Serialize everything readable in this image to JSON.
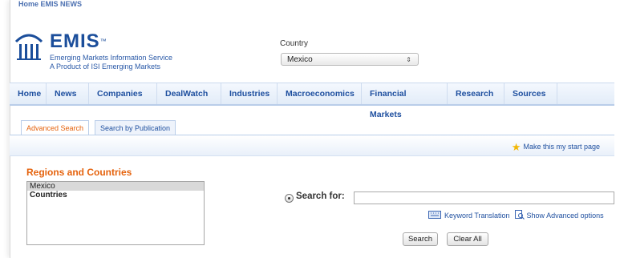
{
  "topbar": {
    "left_text": "Home   EMIS NEWS",
    "right_text": ""
  },
  "logo": {
    "name": "EMIS",
    "tm": "™",
    "line1": "Emerging Markets Information Service",
    "line2": "A Product of ISI Emerging Markets"
  },
  "country": {
    "label": "Country",
    "selected": "Mexico",
    "arrow": "⇕"
  },
  "nav": [
    {
      "label": "Home"
    },
    {
      "label": "News"
    },
    {
      "label": "Companies"
    },
    {
      "label": "DealWatch"
    },
    {
      "label": "Industries"
    },
    {
      "label": "Macroeconomics"
    },
    {
      "label": "Financial Markets"
    },
    {
      "label": "Research"
    },
    {
      "label": "Sources"
    }
  ],
  "tabs": [
    {
      "label": "Advanced Search",
      "active": true
    },
    {
      "label": "Search by Publication",
      "active": false
    }
  ],
  "start_page": {
    "label": "Make this my start page",
    "icon": "★"
  },
  "regions": {
    "title": "Regions and Countries",
    "options": [
      {
        "label": "Mexico",
        "selected": true
      },
      {
        "label": "Countries",
        "group": true
      }
    ]
  },
  "search": {
    "label": "Search for:",
    "value": "",
    "keyword_translation": "Keyword Translation",
    "advanced_options": "Show Advanced options",
    "search_button": "Search",
    "clear_button": "Clear All"
  },
  "colors": {
    "brand_blue": "#1e4f9f",
    "accent_orange": "#e5620c"
  }
}
